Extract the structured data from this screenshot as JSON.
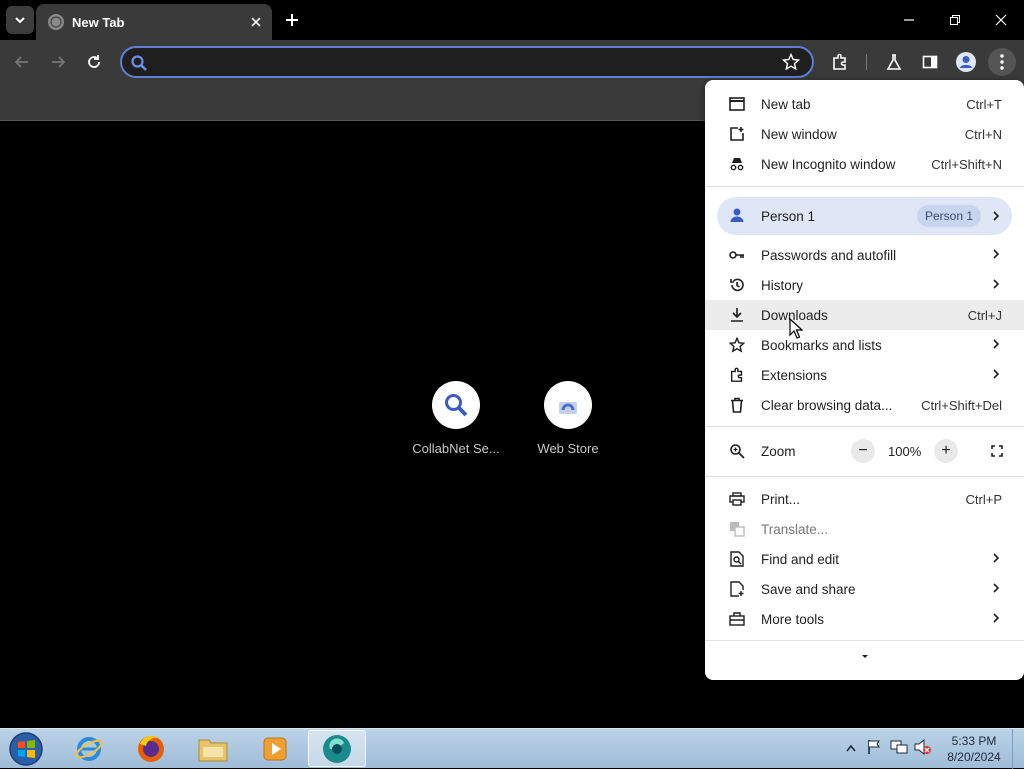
{
  "tab": {
    "title": "New Tab"
  },
  "omnibox": {
    "value": "",
    "placeholder": ""
  },
  "shortcuts": [
    {
      "label": "CollabNet Se..."
    },
    {
      "label": "Web Store"
    }
  ],
  "menu": {
    "items_top": [
      {
        "label": "New tab",
        "shortcut": "Ctrl+T"
      },
      {
        "label": "New window",
        "shortcut": "Ctrl+N"
      },
      {
        "label": "New Incognito window",
        "shortcut": "Ctrl+Shift+N"
      }
    ],
    "profile": {
      "label": "Person 1",
      "badge": "Person 1"
    },
    "items_mid": [
      {
        "label": "Passwords and autofill"
      },
      {
        "label": "History"
      },
      {
        "label": "Downloads",
        "shortcut": "Ctrl+J"
      },
      {
        "label": "Bookmarks and lists"
      },
      {
        "label": "Extensions"
      },
      {
        "label": "Clear browsing data...",
        "shortcut": "Ctrl+Shift+Del"
      }
    ],
    "zoom": {
      "label": "Zoom",
      "value": "100%",
      "minus": "−",
      "plus": "+"
    },
    "items_bottom": [
      {
        "label": "Print...",
        "shortcut": "Ctrl+P"
      },
      {
        "label": "Translate..."
      },
      {
        "label": "Find and edit"
      },
      {
        "label": "Save and share"
      },
      {
        "label": "More tools"
      }
    ]
  },
  "taskbar": {
    "time": "5:33 PM",
    "date": "8/20/2024"
  },
  "colors": {
    "omnibox_border": "#5e7fd4",
    "profile_bg": "#dfe6f5",
    "toolbar_bg": "#3a3a3a"
  }
}
